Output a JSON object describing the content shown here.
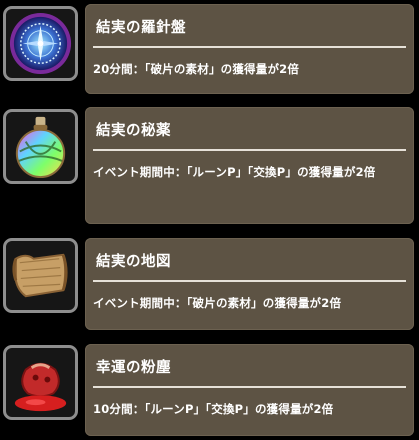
{
  "items": [
    {
      "icon": "compass-orb-icon",
      "name": "結実の羅針盤",
      "description": "20分間：「破片の素材」の獲得量が2倍"
    },
    {
      "icon": "potion-flask-icon",
      "name": "結実の秘薬",
      "description": "イベント期間中：「ルーンP」「交換P」の獲得量が2倍"
    },
    {
      "icon": "map-scroll-icon",
      "name": "結実の地図",
      "description": "イベント期間中：「破片の素材」の獲得量が2倍"
    },
    {
      "icon": "powder-pouch-icon",
      "name": "幸運の粉塵",
      "description": "10分間：「ルーンP」「交換P」の獲得量が2倍"
    }
  ]
}
